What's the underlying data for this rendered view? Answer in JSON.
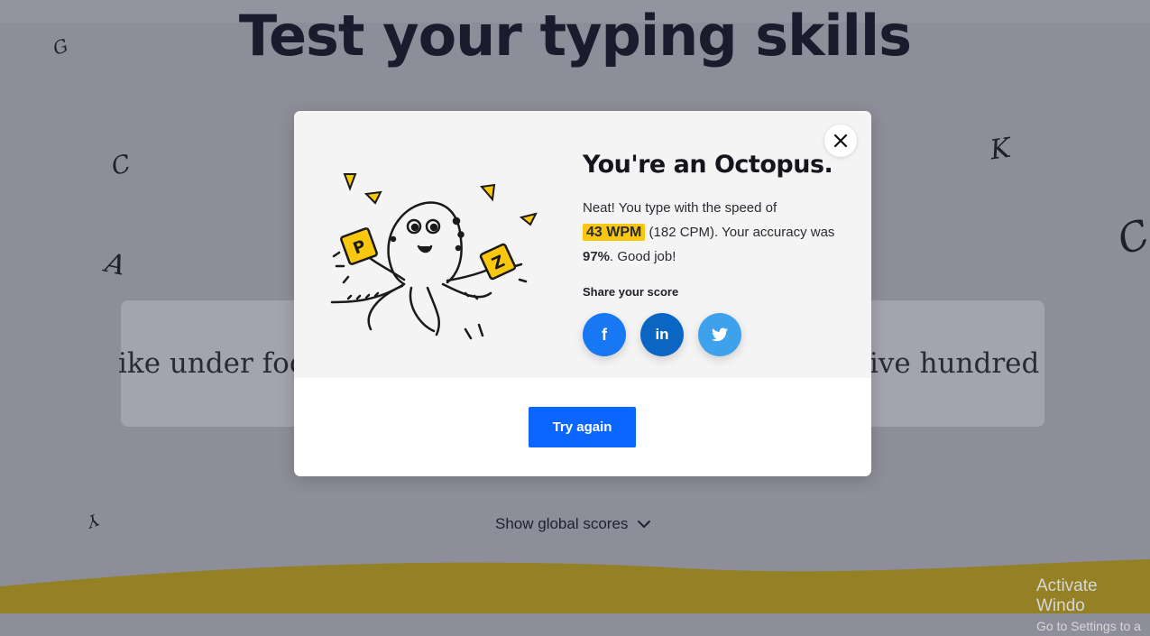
{
  "page": {
    "title": "Test your typing skills",
    "typing_left": "ike under foo",
    "typing_right": "ive hundred",
    "show_global_scores": "Show global scores",
    "deco_letters": [
      "G",
      "C",
      "A",
      "K",
      "C",
      "Y"
    ]
  },
  "modal": {
    "title": "You're an Octopus.",
    "text_before": "Neat! You type with the speed of",
    "wpm": "43 WPM",
    "cpm_text": "(182 CPM). Your accuracy was",
    "accuracy": "97%",
    "text_after": ". Good job!",
    "share_label": "Share your score",
    "share": {
      "facebook": "f",
      "linkedin": "in",
      "twitter_icon": "twitter-bird-icon"
    },
    "try_again": "Try again",
    "close_icon": "close-icon",
    "cards": [
      "P",
      "Z"
    ]
  },
  "os": {
    "activate_line1": "Activate Windo",
    "activate_line2": "Go to Settings to a"
  },
  "colors": {
    "overlay_bg": "#8e8e9a",
    "accent_blue": "#0b66ff",
    "highlight_yellow": "#f9c80e",
    "facebook": "#1877f2",
    "linkedin": "#0a66c2",
    "twitter": "#3ea1ec",
    "wave": "#948025"
  }
}
